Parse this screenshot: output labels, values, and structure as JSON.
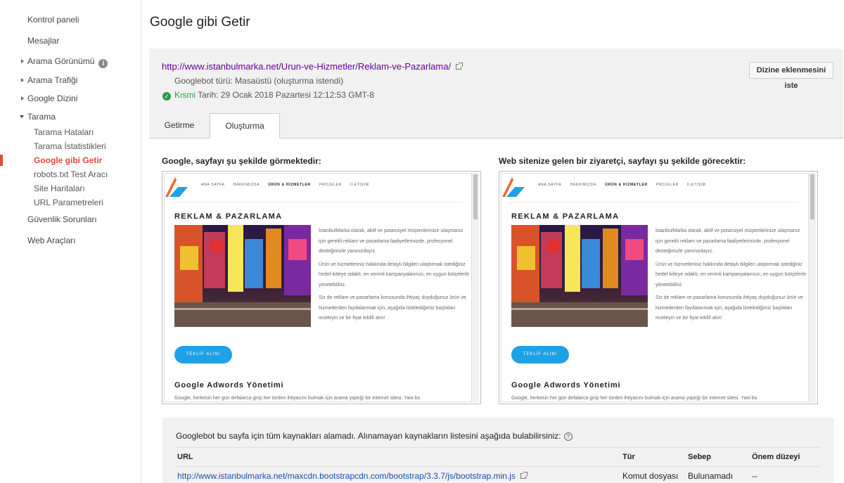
{
  "sidebar": {
    "items": [
      {
        "label": "Kontrol paneli"
      },
      {
        "label": "Mesajlar"
      },
      {
        "label": "Arama Görünümü"
      },
      {
        "label": "Arama Trafiği"
      },
      {
        "label": "Google Dizini"
      },
      {
        "label": "Tarama"
      },
      {
        "label": "Güvenlik Sorunları"
      },
      {
        "label": "Web Araçları"
      }
    ],
    "sub_items": [
      {
        "label": "Tarama Hataları"
      },
      {
        "label": "Tarama İstatistikleri"
      },
      {
        "label": "Google gibi Getir"
      },
      {
        "label": "robots.txt Test Aracı"
      },
      {
        "label": "Site Haritaları"
      },
      {
        "label": "URL Parametreleri"
      }
    ]
  },
  "page": {
    "title": "Google gibi Getir"
  },
  "fetch": {
    "url": "http://www.istanbulmarka.net/Urun-ve-Hizmetler/Reklam-ve-Pazarlama/",
    "bot_type": "Googlebot türü: Masaüstü (oluşturma istendi)",
    "status": "Kısmi",
    "date": "Tarih: 29 Ocak 2018 Pazartesi 12:12:53 GMT-8",
    "request_button": "Dizine eklenmesini iste"
  },
  "tabs": [
    {
      "label": "Getirme"
    },
    {
      "label": "Oluşturma"
    }
  ],
  "previews": {
    "google_heading": "Google, sayfayı şu şekilde görmektedir:",
    "visitor_heading": "Web sitenize gelen bir ziyaretçi, sayfayı şu şekilde görecektir:",
    "site": {
      "nav": [
        "ANA SAYFA",
        "HAKKIMIZDA",
        "ÜRÜN & HİZMETLER",
        "PROJELER",
        "İLETİŞİM"
      ],
      "title": "REKLAM & PAZARLAMA",
      "para1": "İstanbulMarka olarak, aktif ve potansiyel müşterilerinize ulaşmanız için gerekli reklam ve pazarlama faaliyetlerinizde, profesyonel desteğimizle yanınızdayız.",
      "para2": "Ürün ve hizmetleriniz hakkında detaylı bilgileri ulaştırmak istediğiniz hedef kitleye odaklı, en verimli kampanyalarınızı, en uygun bütçelerle yönetebiliriz.",
      "para3": "Siz de reklam ve pazarlama konusunda ihtiyaç duyduğunuz ürün ve hizmetlerden faydalanmak için, aşağıda listelediğimiz başlıkları inceleyin ve bir fiyat teklifi alın!",
      "button": "TEKLİF ALIN!",
      "subtitle": "Google Adwords Yönetimi",
      "footer": "Google, herkesin her gün defalarca girip her türden ihtiyacını bulmak için arama yaptığı bir internet sitesi. Yani bu"
    }
  },
  "resources": {
    "message": "Googlebot bu sayfa için tüm kaynakları alamadı. Alınamayan kaynakların listesini aşağıda bulabilirsiniz:",
    "columns": [
      "URL",
      "Tür",
      "Sebep",
      "Önem düzeyi"
    ],
    "rows": [
      {
        "url": "http://www.istanbulmarka.net/maxcdn.bootstrapcdn.com/bootstrap/3.3.7/js/bootstrap.min.js",
        "type": "Komut dosyası",
        "reason": "Bulunamadı",
        "severity": "--"
      }
    ]
  },
  "colors": {
    "active": "#dd4b39",
    "link": "#1a4eaa",
    "visited_link": "#660099",
    "success": "#2a9a4a",
    "site_button": "#1ea1e6"
  }
}
